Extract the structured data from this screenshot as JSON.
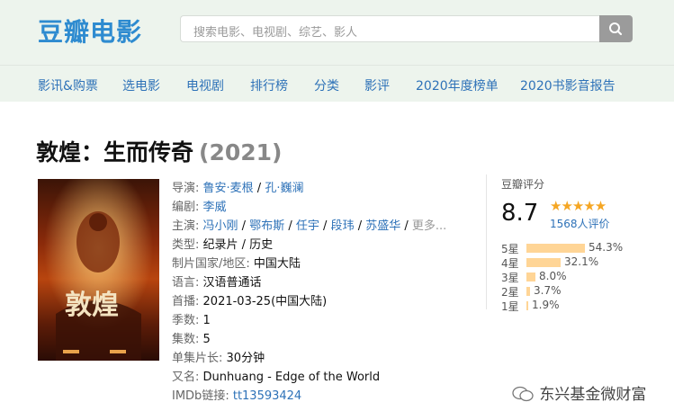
{
  "header": {
    "logo": "豆瓣电影",
    "search_placeholder": "搜索电影、电视剧、综艺、影人"
  },
  "nav": [
    "影讯&购票",
    "选电影",
    "电视剧",
    "排行榜",
    "分类",
    "影评",
    "2020年度榜单",
    "2020书影音报告"
  ],
  "movie": {
    "title": "敦煌：生而传奇",
    "year": "(2021)",
    "director_key": "导演:",
    "directors": [
      "鲁安·麦根",
      "孔·巍澜"
    ],
    "writer_key": "编剧:",
    "writer": "李威",
    "cast_key": "主演:",
    "cast": [
      "冯小刚",
      "鄂布斯",
      "任宇",
      "段玮",
      "苏盛华"
    ],
    "more": "更多...",
    "genre_key": "类型:",
    "genre": "纪录片 / 历史",
    "region_key": "制片国家/地区:",
    "region": "中国大陆",
    "language_key": "语言:",
    "language": "汉语普通话",
    "premiere_key": "首播:",
    "premiere": "2021-03-25(中国大陆)",
    "seasons_key": "季数:",
    "seasons": "1",
    "episodes_key": "集数:",
    "episodes": "5",
    "runtime_key": "单集片长:",
    "runtime": "30分钟",
    "aka_key": "又名:",
    "aka": "Dunhuang - Edge of the World",
    "imdb_key": "IMDb链接:",
    "imdb": "tt13593424"
  },
  "rating": {
    "label": "豆瓣评分",
    "score": "8.7",
    "stars": 4.5,
    "votes": "1568人评价",
    "breakdown": [
      {
        "label": "5星",
        "pct": "54.3%",
        "value": 54.3
      },
      {
        "label": "4星",
        "pct": "32.1%",
        "value": 32.1
      },
      {
        "label": "3星",
        "pct": "8.0%",
        "value": 8.0
      },
      {
        "label": "2星",
        "pct": "3.7%",
        "value": 3.7
      },
      {
        "label": "1星",
        "pct": "1.9%",
        "value": 1.9
      }
    ]
  },
  "watermark": "东兴基金微财富",
  "colors": {
    "accent": "#2e8bd0",
    "link": "#2e72b8",
    "bar": "#ffd596",
    "star": "#f5a623"
  }
}
